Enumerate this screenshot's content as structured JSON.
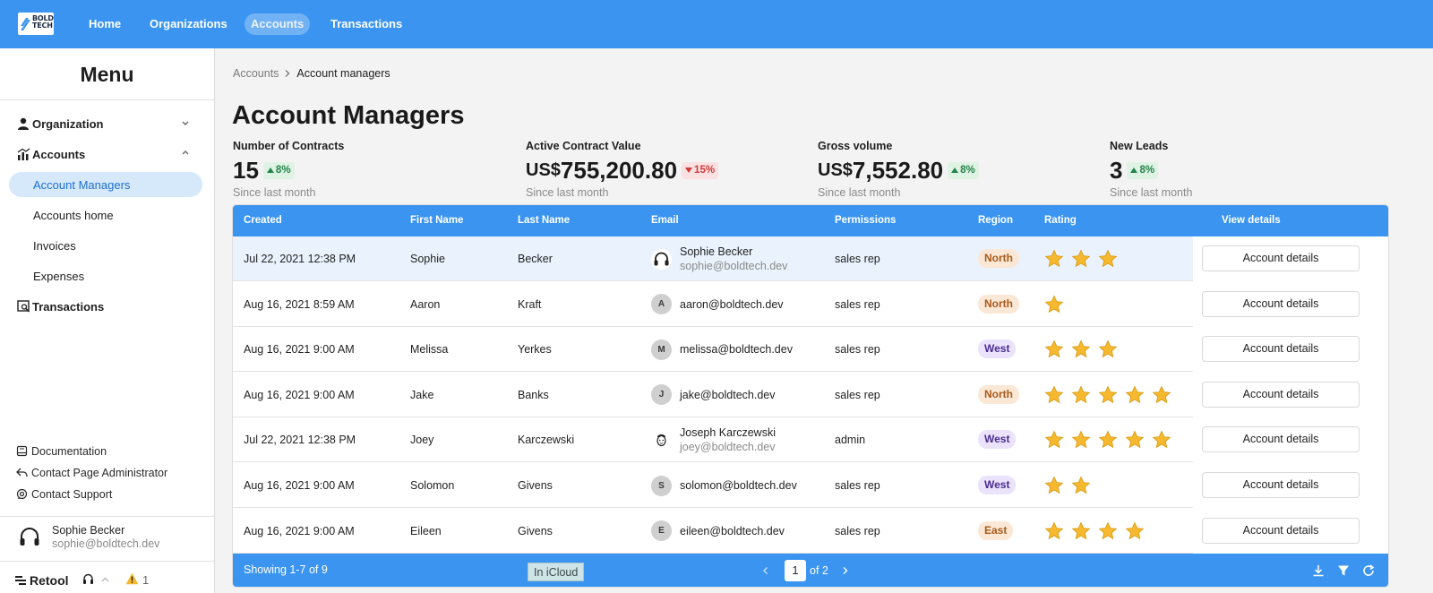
{
  "brand": {
    "logo_text_top": "BOLD",
    "logo_text_bottom": "TECH"
  },
  "topnav": [
    {
      "label": "Home",
      "active": false
    },
    {
      "label": "Organizations",
      "active": false
    },
    {
      "label": "Accounts",
      "active": true
    },
    {
      "label": "Transactions",
      "active": false
    }
  ],
  "sidebar": {
    "title": "Menu",
    "items": [
      {
        "label": "Organization",
        "icon": "person-icon",
        "expanded": false
      },
      {
        "label": "Accounts",
        "icon": "chart-icon",
        "expanded": true
      },
      {
        "label": "Account Managers",
        "selected": true
      },
      {
        "label": "Accounts home"
      },
      {
        "label": "Invoices"
      },
      {
        "label": "Expenses"
      },
      {
        "label": "Transactions",
        "icon": "search-doc-icon"
      }
    ],
    "footer_links": [
      {
        "label": "Documentation",
        "icon": "book-icon"
      },
      {
        "label": "Contact Page Administrator",
        "icon": "reply-icon"
      },
      {
        "label": "Contact Support",
        "icon": "support-icon"
      }
    ],
    "user": {
      "name": "Sophie Becker",
      "email": "sophie@boldtech.dev"
    },
    "retool": {
      "label": "Retool",
      "warnings": "1"
    }
  },
  "breadcrumb": {
    "root": "Accounts",
    "current": "Account managers"
  },
  "page_title": "Account Managers",
  "stats": [
    {
      "label": "Number of Contracts",
      "prefix": "",
      "value": "15",
      "change": "8%",
      "direction": "up",
      "since": "Since last month"
    },
    {
      "label": "Active Contract Value",
      "prefix": "US$",
      "value": "755,200.80",
      "change": "15%",
      "direction": "down",
      "since": "Since last month"
    },
    {
      "label": "Gross volume",
      "prefix": "US$",
      "value": "7,552.80",
      "change": "8%",
      "direction": "up",
      "since": "Since last month"
    },
    {
      "label": "New Leads",
      "prefix": "",
      "value": "3",
      "change": "8%",
      "direction": "up",
      "since": "Since last month"
    }
  ],
  "table": {
    "columns": [
      "Created",
      "First Name",
      "Last Name",
      "Email",
      "Permissions",
      "Region",
      "Rating",
      "View details"
    ],
    "rows": [
      {
        "created": "Jul 22, 2021 12:38 PM",
        "first": "Sophie",
        "last": "Becker",
        "avatar": "headphones-avatar",
        "email_name": "Sophie Becker",
        "email": "sophie@boldtech.dev",
        "permissions": "sales rep",
        "region": "North",
        "rating": 3,
        "action": "Account details"
      },
      {
        "created": "Aug 16, 2021 8:59 AM",
        "first": "Aaron",
        "last": "Kraft",
        "avatar": "A",
        "email_name": "",
        "email": "aaron@boldtech.dev",
        "permissions": "sales rep",
        "region": "North",
        "rating": 1,
        "action": "Account details"
      },
      {
        "created": "Aug 16, 2021 9:00 AM",
        "first": "Melissa",
        "last": "Yerkes",
        "avatar": "M",
        "email_name": "",
        "email": "melissa@boldtech.dev",
        "permissions": "sales rep",
        "region": "West",
        "rating": 3,
        "action": "Account details"
      },
      {
        "created": "Aug 16, 2021 9:00 AM",
        "first": "Jake",
        "last": "Banks",
        "avatar": "J",
        "email_name": "",
        "email": "jake@boldtech.dev",
        "permissions": "sales rep",
        "region": "North",
        "rating": 5,
        "action": "Account details"
      },
      {
        "created": "Jul 22, 2021 12:38 PM",
        "first": "Joey",
        "last": "Karczewski",
        "avatar": "face-avatar",
        "email_name": "Joseph Karczewski",
        "email": "joey@boldtech.dev",
        "permissions": "admin",
        "region": "West",
        "rating": 5,
        "action": "Account details"
      },
      {
        "created": "Aug 16, 2021 9:00 AM",
        "first": "Solomon",
        "last": "Givens",
        "avatar": "S",
        "email_name": "",
        "email": "solomon@boldtech.dev",
        "permissions": "sales rep",
        "region": "West",
        "rating": 2,
        "action": "Account details"
      },
      {
        "created": "Aug 16, 2021 9:00 AM",
        "first": "Eileen",
        "last": "Givens",
        "avatar": "E",
        "email_name": "",
        "email": "eileen@boldtech.dev",
        "permissions": "sales rep",
        "region": "East",
        "rating": 4,
        "action": "Account details"
      }
    ],
    "footer": {
      "showing": "Showing 1-7 of 9",
      "tooltip": "In iCloud",
      "page": "1",
      "of_pages": "of 2"
    }
  },
  "colors": {
    "primary": "#3b95f0",
    "star": "#f5b82e",
    "up": "#23834b",
    "down": "#d23a3a"
  }
}
